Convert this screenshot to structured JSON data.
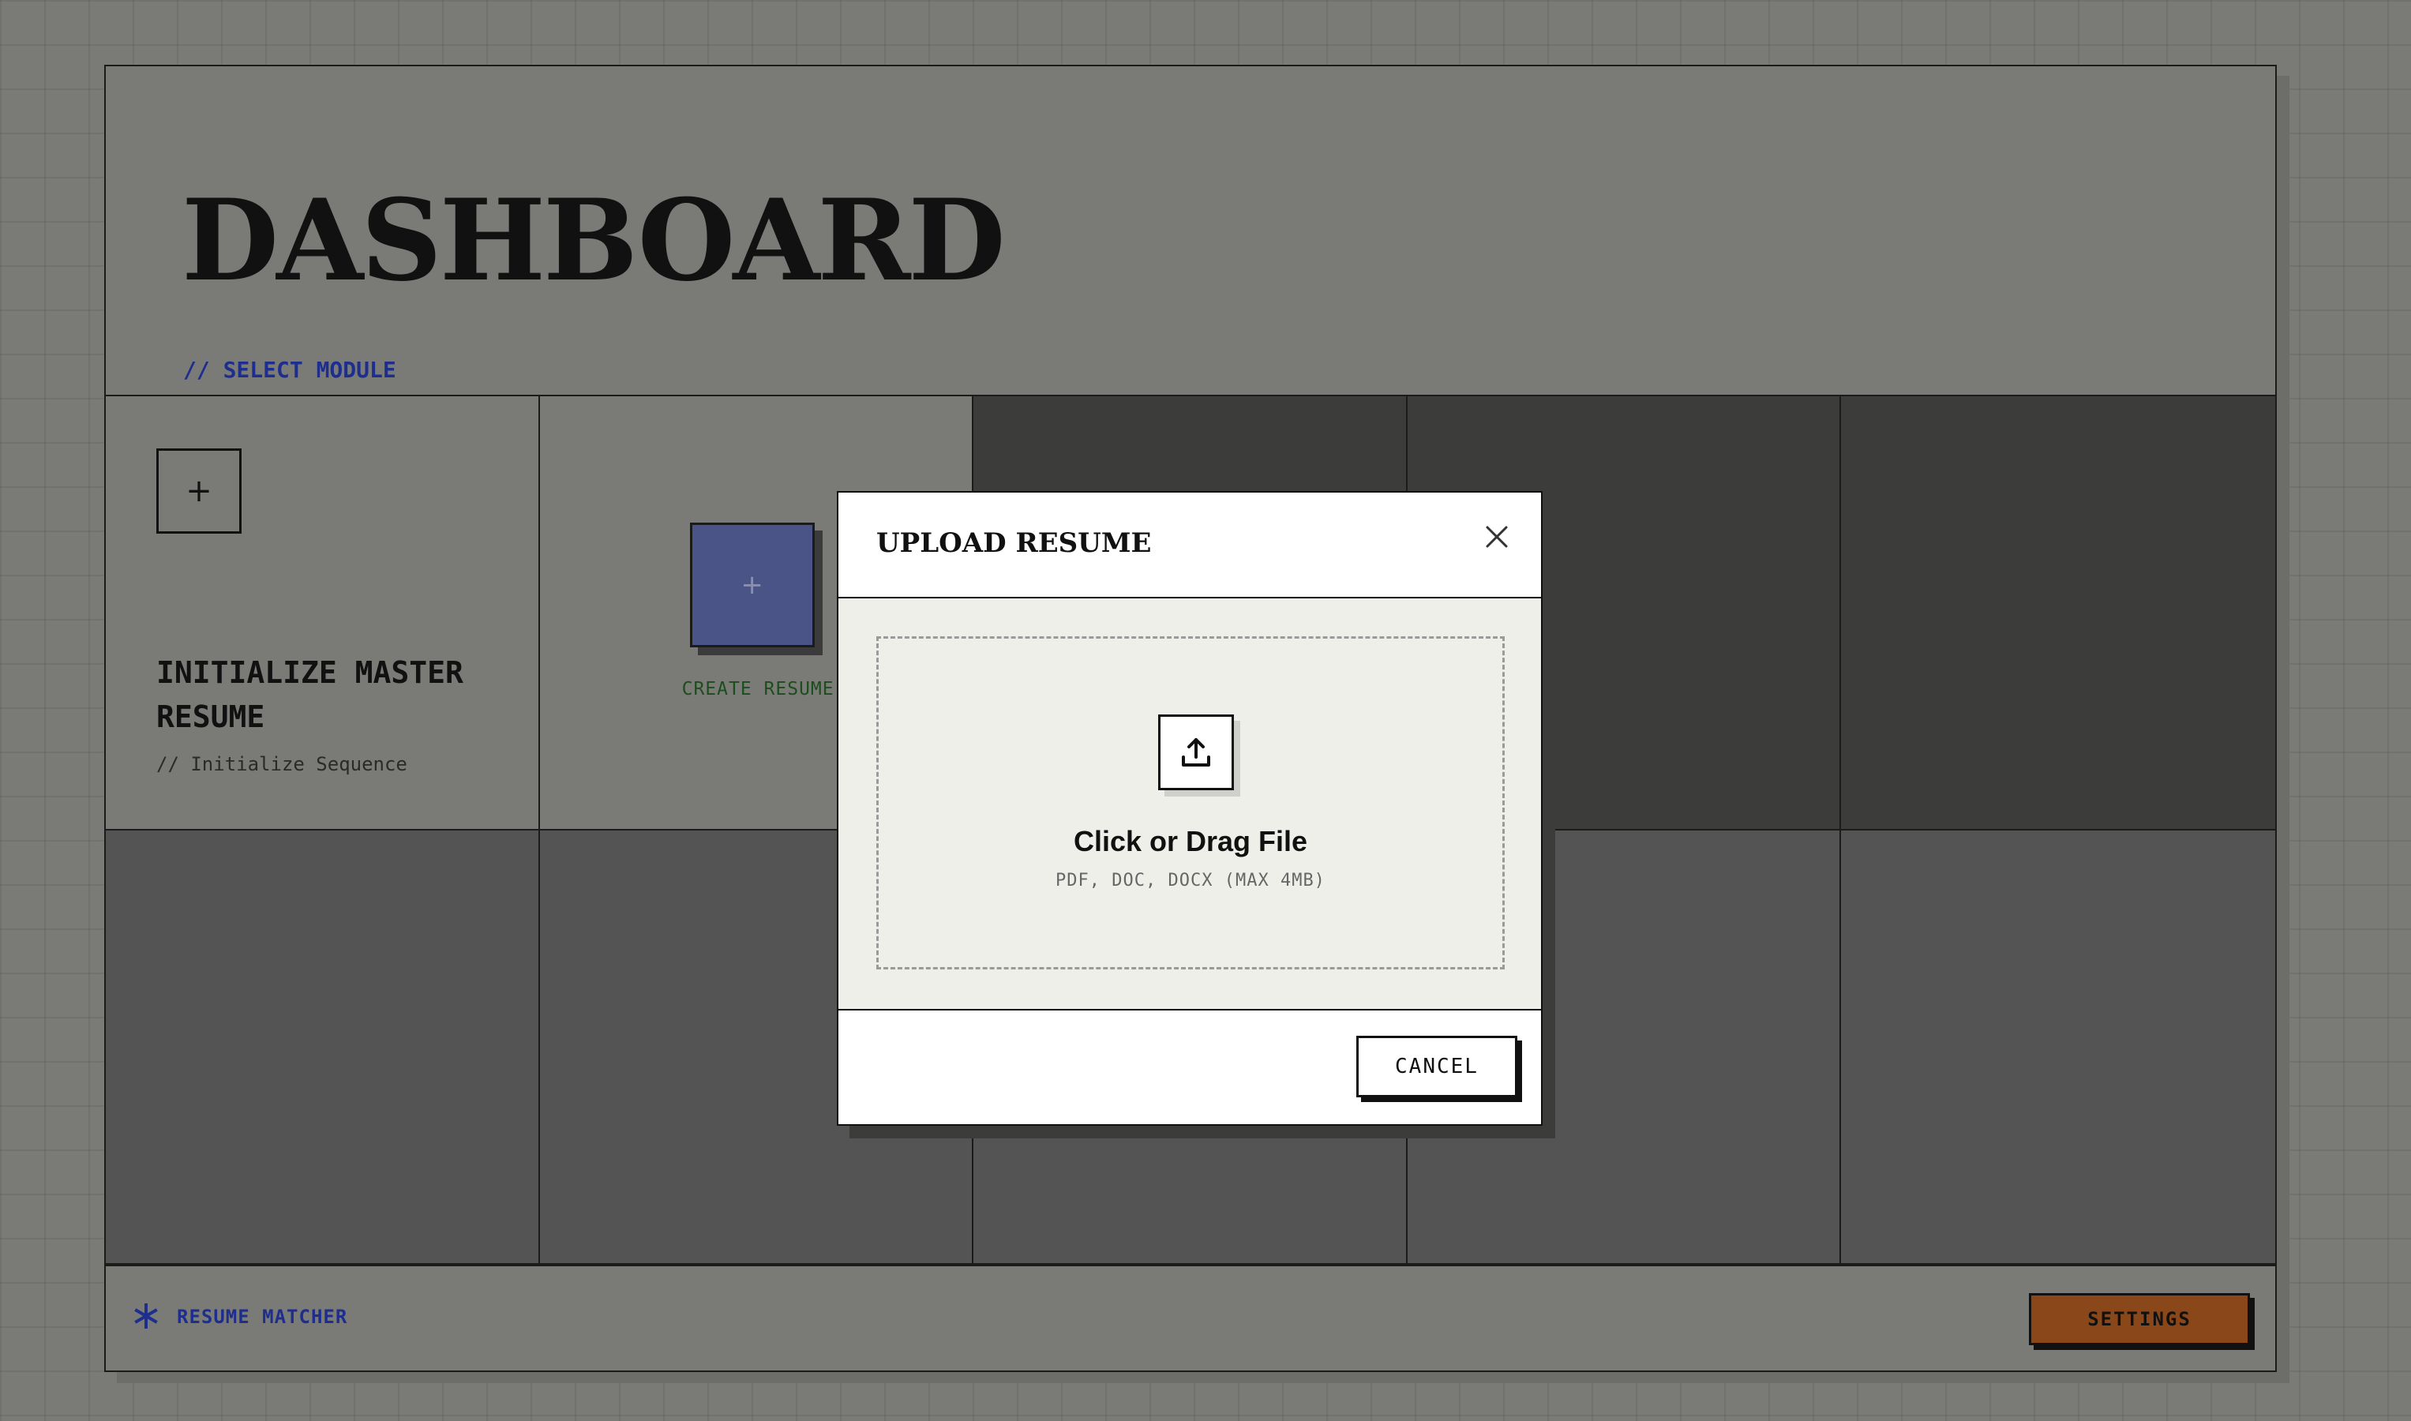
{
  "header": {
    "title": "DASHBOARD",
    "subtitle": "// SELECT MODULE"
  },
  "modules": {
    "init_master": {
      "icon": "plus-icon",
      "title": "INITIALIZE MASTER RESUME",
      "subtitle": "// Initialize Sequence"
    },
    "create_resume": {
      "icon": "plus-icon",
      "label": "CREATE RESUME"
    }
  },
  "footer": {
    "brand_icon": "asterisk-icon",
    "brand": "RESUME MATCHER",
    "settings_label": "SETTINGS"
  },
  "modal": {
    "title": "UPLOAD RESUME",
    "close_icon": "close-icon",
    "upload_icon": "upload-icon",
    "drop_title": "Click or Drag File",
    "drop_hint": "PDF, DOC, DOCX (MAX 4MB)",
    "cancel_label": "CANCEL"
  },
  "colors": {
    "background": "#7a7b77",
    "accent_blue": "#1e2e8e",
    "settings_orange": "#8a4719",
    "create_button": "#4a5486",
    "create_label": "#1d4d1d"
  }
}
